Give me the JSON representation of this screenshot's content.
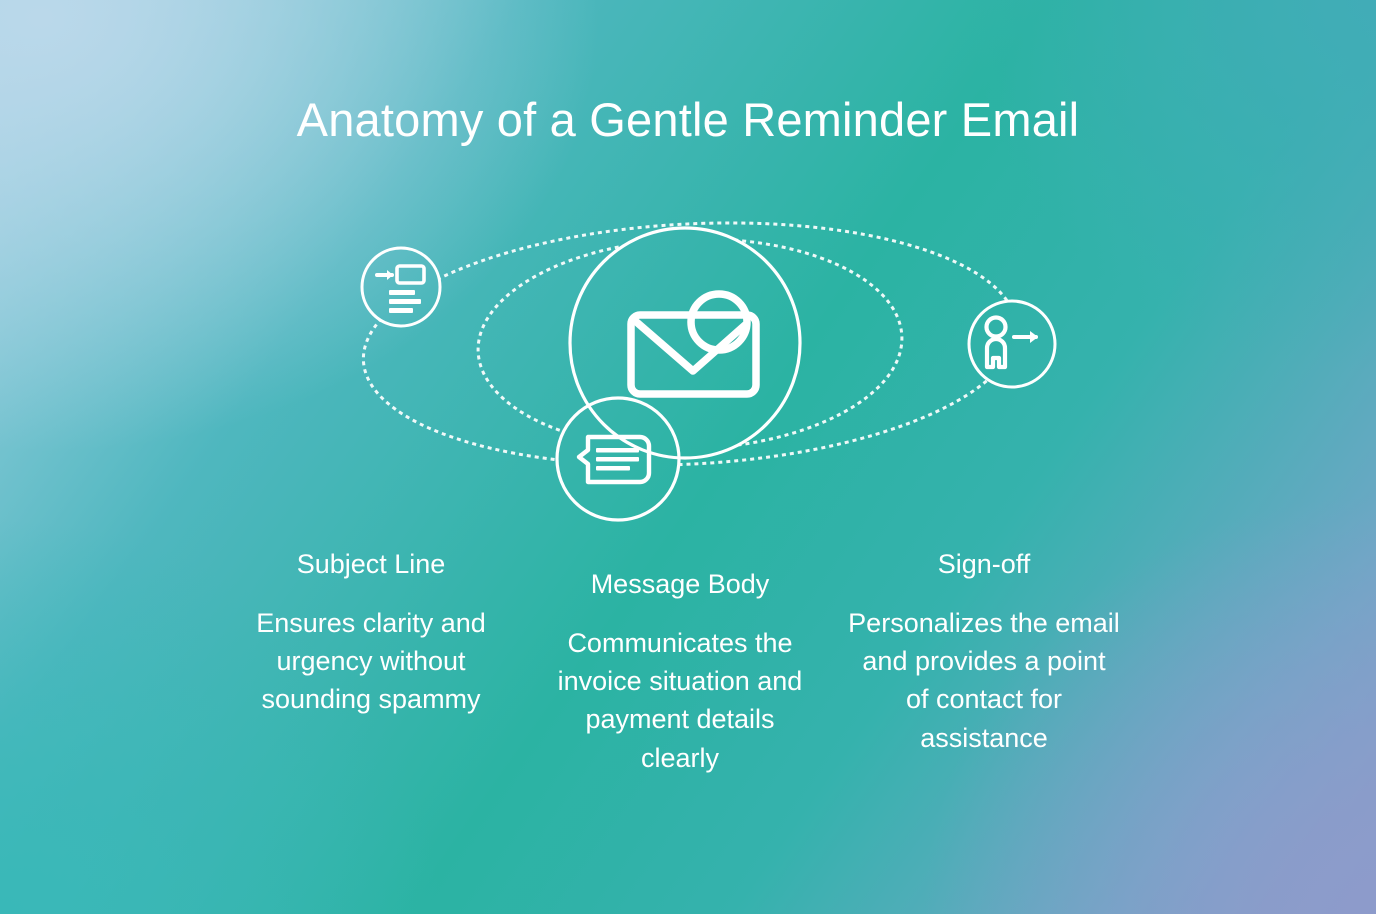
{
  "page": {
    "title": "Anatomy of a Gentle Reminder Email",
    "background": {
      "gradient_stops": [
        "#a9d3e6",
        "#4fb7bf",
        "#2bb3a3",
        "#35b2ad",
        "#6fa7c6",
        "#8e9ccb"
      ],
      "accent_line_color": "#ffffff"
    }
  },
  "diagram": {
    "center_node": {
      "icon": "envelope-with-contact-icon",
      "label": ""
    },
    "nodes": [
      {
        "icon": "subject-line-field-icon",
        "label": "Subject Line"
      },
      {
        "icon": "message-bubble-icon",
        "label": "Message Body"
      },
      {
        "icon": "person-exit-arrow-icon",
        "label": "Sign-off"
      }
    ],
    "orbits": [
      {
        "name": "outer-orbit-ellipse",
        "style": "dashed"
      },
      {
        "name": "inner-orbit-ellipse",
        "style": "dashed"
      }
    ]
  },
  "columns": [
    {
      "key": "subject",
      "heading": "Subject Line",
      "description": "Ensures clarity and urgency without sounding spammy"
    },
    {
      "key": "body",
      "heading": "Message Body",
      "description": "Communicates the invoice situation and payment details clearly"
    },
    {
      "key": "signoff",
      "heading": "Sign-off",
      "description": "Personalizes the email and provides a point of contact for assistance"
    }
  ]
}
